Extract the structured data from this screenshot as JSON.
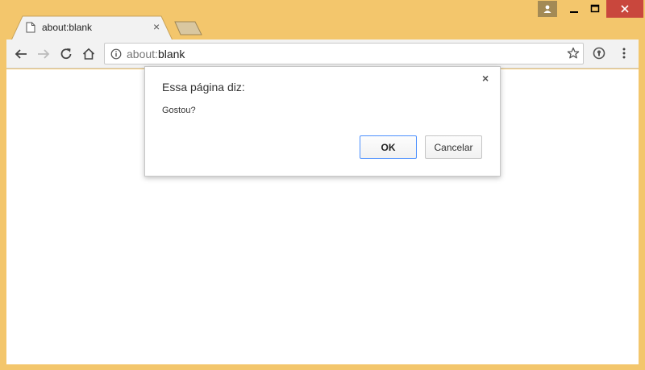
{
  "window": {
    "controls": {
      "minimize": "minimize",
      "maximize": "maximize",
      "close": "close"
    },
    "colors": {
      "frame": "#f3c66c",
      "close": "#c9473d",
      "user": "#a38a55"
    }
  },
  "tabs": [
    {
      "label": "about:blank",
      "active": true
    }
  ],
  "omnibox": {
    "scheme": "about:",
    "rest": "blank"
  },
  "dialog": {
    "title": "Essa página diz:",
    "message": "Gostou?",
    "ok_label": "OK",
    "cancel_label": "Cancelar",
    "close_glyph": "×"
  },
  "tab_close_glyph": "×"
}
